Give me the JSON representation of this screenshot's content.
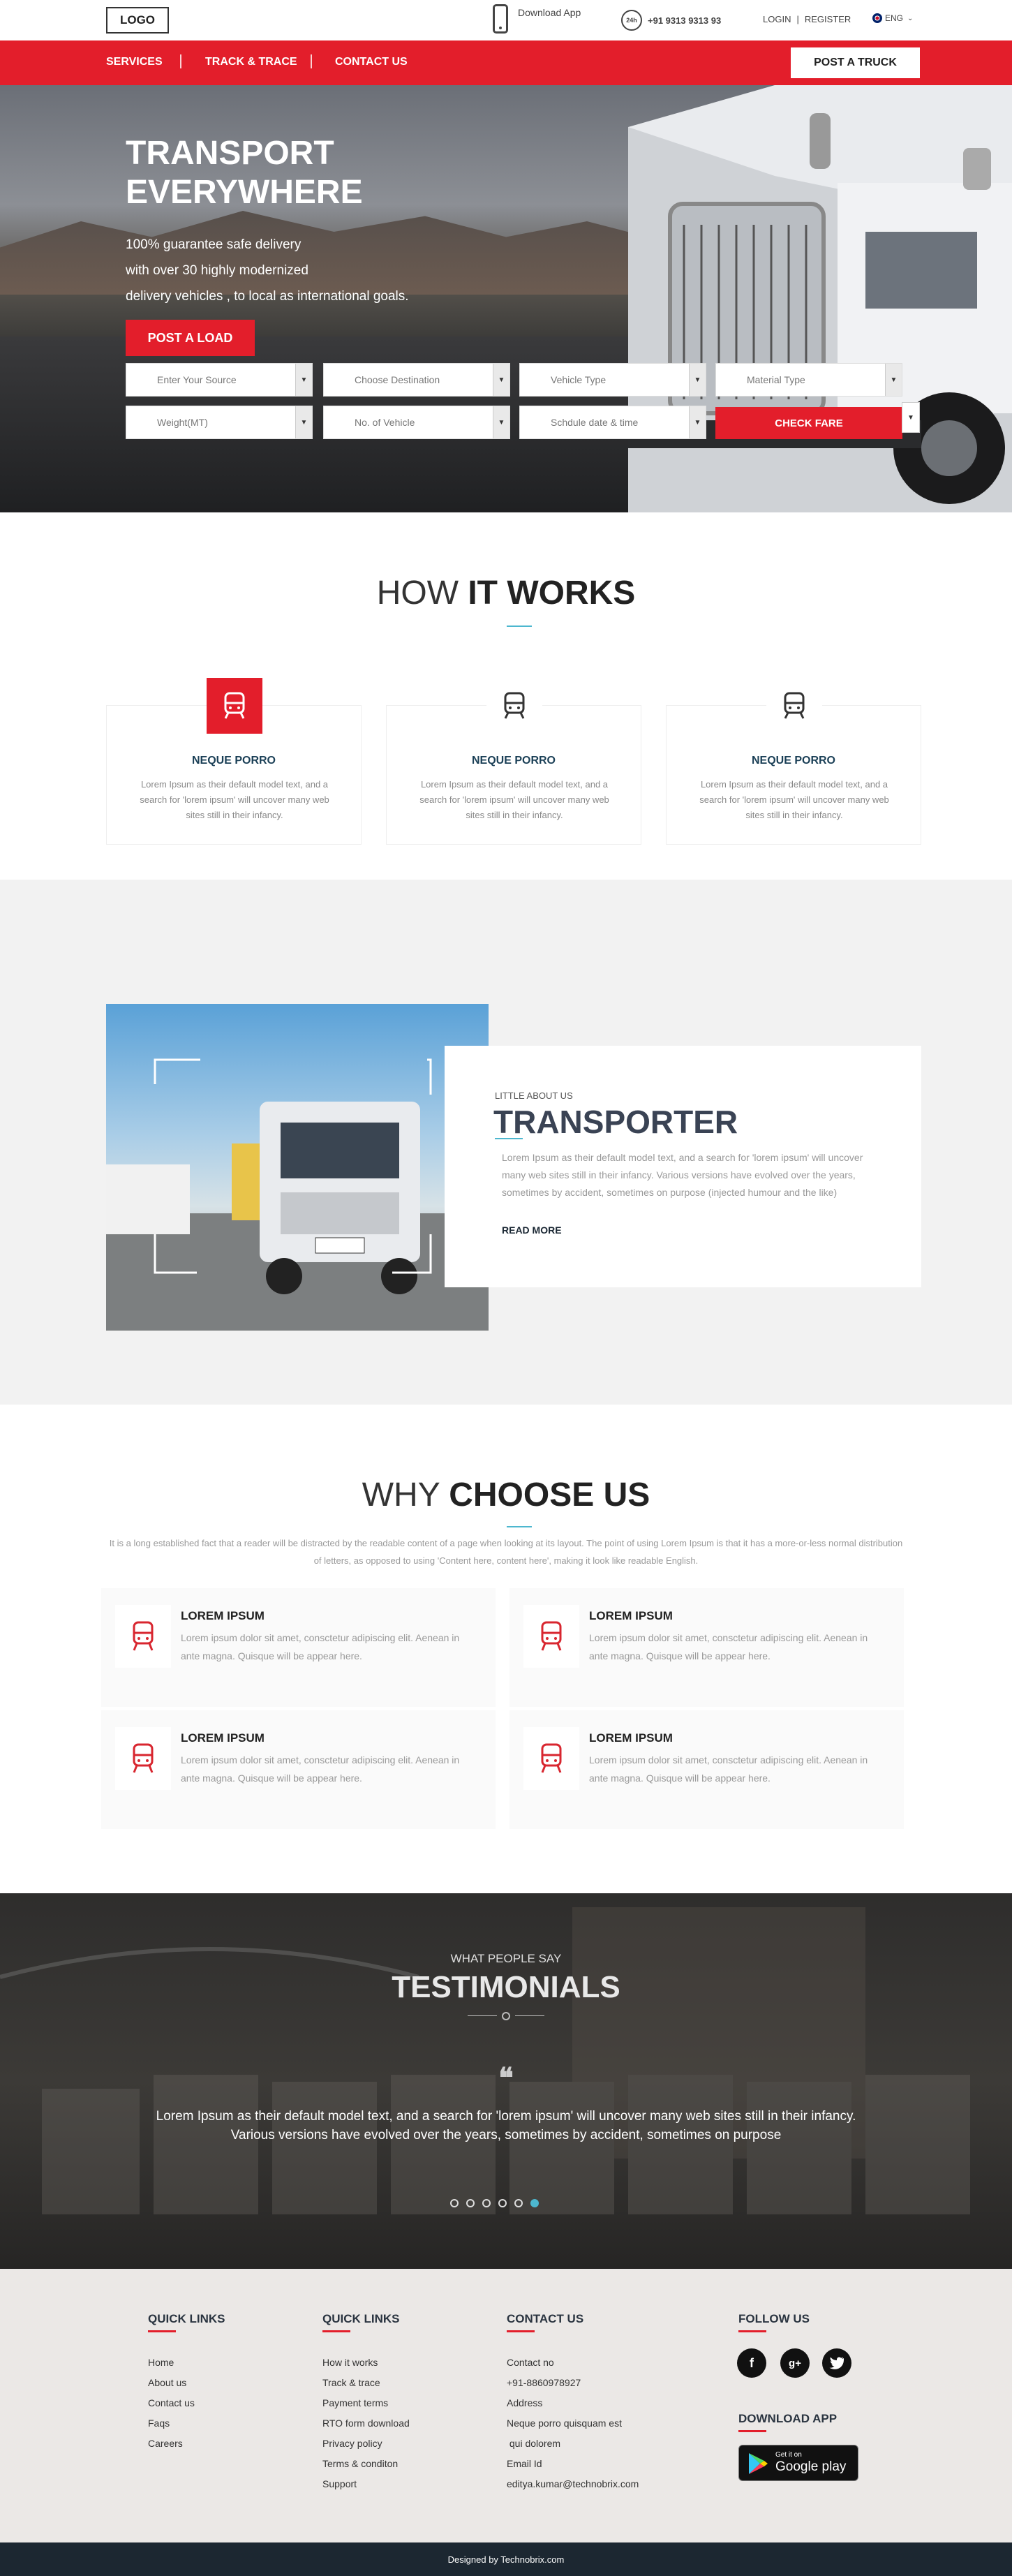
{
  "topbar": {
    "logo": "LOGO",
    "download_app": "Download App",
    "phone_badge": "24h",
    "phone": "+91 9313 9313 93",
    "login": "LOGIN",
    "sep": "|",
    "register": "REGISTER",
    "lang": "ENG"
  },
  "nav": {
    "items": [
      "SERVICES",
      "TRACK & TRACE",
      "CONTACT US"
    ],
    "post_truck": "POST A TRUCK"
  },
  "hero": {
    "title_line1": "TRANSPORT",
    "title_line2": "EVERYWHERE",
    "sub_line1": "100% guarantee safe delivery",
    "sub_line2": "with over 30 highly modernized",
    "sub_line3": "delivery vehicles , to local as international goals.",
    "post_load": "POST A LOAD",
    "fields": [
      "Enter Your Source",
      "Choose Destination",
      "Vehicle Type",
      "Material Type",
      "Weight(MT)",
      "No. of Vehicle",
      "Schdule date & time"
    ],
    "check_fare": "CHECK FARE"
  },
  "how": {
    "title_light": "HOW ",
    "title_bold": "IT WORKS",
    "cards": [
      {
        "title": "NEQUE PORRO",
        "text": "Lorem Ipsum as their default model text, and a search for 'lorem ipsum' will uncover many web sites still in their infancy."
      },
      {
        "title": "NEQUE PORRO",
        "text": "Lorem Ipsum as their default model text, and a search for 'lorem ipsum' will uncover many web sites still in their infancy."
      },
      {
        "title": "NEQUE PORRO",
        "text": "Lorem Ipsum as their default model text, and a search for 'lorem ipsum' will uncover many web sites still in their infancy."
      }
    ]
  },
  "transporter": {
    "eyebrow": "LITTLE ABOUT US",
    "title": "TRANSPORTER",
    "text": "Lorem Ipsum as their default model text, and a search for 'lorem ipsum' will uncover many web sites still in their infancy. Various versions have evolved over the years, sometimes by accident, sometimes on purpose (injected humour and the like)",
    "read_more": "READ MORE"
  },
  "why": {
    "title_light": "WHY ",
    "title_bold": "CHOOSE US",
    "desc": "It is a long established fact that a reader will be distracted by the readable content of a page when looking at its layout. The point of using Lorem Ipsum is that it has a more-or-less normal distribution of letters, as opposed to using 'Content here, content here', making it look like readable English.",
    "cards": [
      {
        "title": "LOREM IPSUM",
        "text": "Lorem ipsum dolor sit amet, consctetur adipiscing elit. Aenean in ante magna. Quisque will be appear here."
      },
      {
        "title": "LOREM IPSUM",
        "text": "Lorem ipsum dolor sit amet, consctetur adipiscing elit. Aenean in ante magna. Quisque will be appear here."
      },
      {
        "title": "LOREM IPSUM",
        "text": "Lorem ipsum dolor sit amet, consctetur adipiscing elit. Aenean in ante magna. Quisque will be appear here."
      },
      {
        "title": "LOREM IPSUM",
        "text": "Lorem ipsum dolor sit amet, consctetur adipiscing elit. Aenean in ante magna. Quisque will be appear here."
      }
    ]
  },
  "testimonials": {
    "eyebrow": "WHAT PEOPLE SAY",
    "title": "TESTIMONIALS",
    "quote_mark": "❝",
    "text": "Lorem Ipsum as their default model text, and a search for 'lorem ipsum' will uncover many web sites still in their infancy. Various versions have evolved over the years, sometimes by accident, sometimes on purpose",
    "active_dot": 6
  },
  "footer": {
    "col1": {
      "title": "QUICK LINKS",
      "links": [
        "Home",
        "About us",
        "Contact us",
        "Faqs",
        "Careers"
      ]
    },
    "col2": {
      "title": "QUICK LINKS",
      "links": [
        "How it works",
        "Track & trace",
        "Payment terms",
        "RTO form download",
        "Privacy policy",
        "Terms & conditon",
        "Support"
      ]
    },
    "col3": {
      "title": "CONTACT US",
      "lines": [
        "Contact no",
        "+91-8860978927",
        "Address",
        "Neque porro quisquam est",
        " qui dolorem",
        "Email Id",
        "editya.kumar@technobrix.com"
      ]
    },
    "follow": {
      "title": "FOLLOW US"
    },
    "download": {
      "title": "DOWNLOAD  APP",
      "badge_small": "Get it on",
      "badge_big": "Google play"
    },
    "credit": "Designed by Technobrix.com"
  },
  "colors": {
    "accent": "#e31e2b",
    "teal": "#4db7cf",
    "navy": "#1a3f56",
    "footer_bg": "#ebe8e6",
    "bottom_bar": "#1c2731"
  }
}
